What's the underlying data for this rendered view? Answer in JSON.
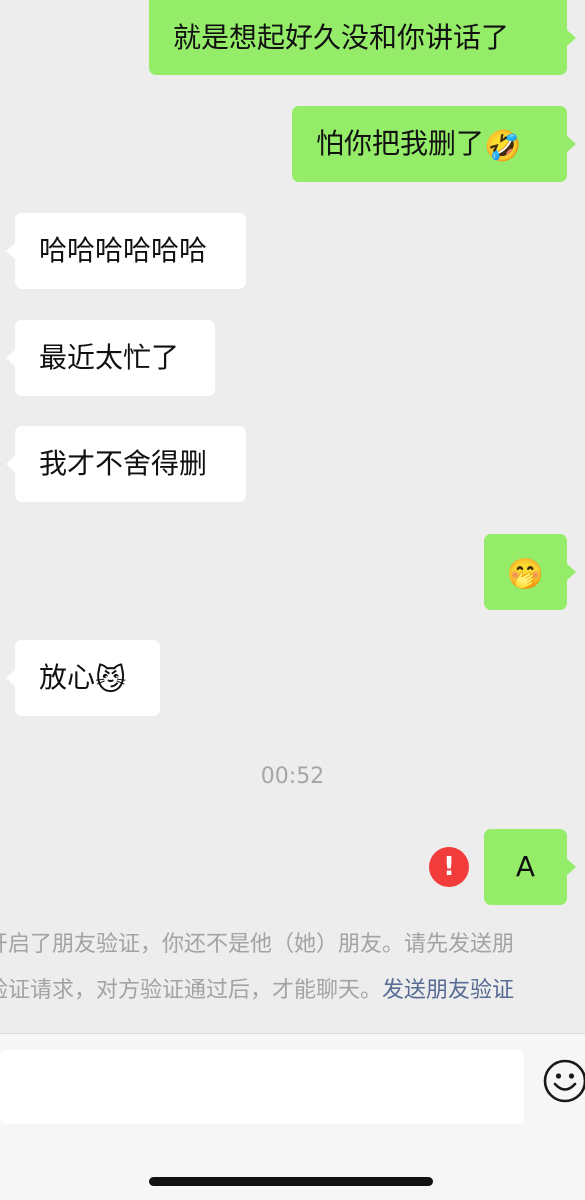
{
  "messages": [
    {
      "id": "m1",
      "side": "out",
      "text": "就是想起好久没和你讲话了",
      "emoji": ""
    },
    {
      "id": "m2",
      "side": "out",
      "text": "怕你把我删了",
      "emoji": "🤣"
    },
    {
      "id": "m3",
      "side": "in",
      "text": "哈哈哈哈哈哈",
      "emoji": ""
    },
    {
      "id": "m4",
      "side": "in",
      "text": "最近太忙了",
      "emoji": ""
    },
    {
      "id": "m5",
      "side": "in",
      "text": "我才不舍得删",
      "emoji": ""
    },
    {
      "id": "m6",
      "side": "out",
      "text": "",
      "emoji": "🤭"
    },
    {
      "id": "m7",
      "side": "in",
      "text": "放心",
      "emoji": "😼"
    },
    {
      "id": "m8",
      "side": "out",
      "text": "A",
      "emoji": "",
      "failed": true
    }
  ],
  "timestamp": "00:52",
  "failed_icon_glyph": "!",
  "system_note": {
    "line1": "开启了朋友验证，你还不是他（她）朋友。请先发送朋",
    "line2_prefix": "验证请求，对方验证通过后，才能聊天。",
    "line2_link": "发送朋友验证"
  },
  "input": {
    "value": "",
    "emoji_icon": "smiley-icon"
  },
  "colors": {
    "background": "#ededed",
    "outgoing_bubble": "#95ec69",
    "incoming_bubble": "#ffffff",
    "link": "#576b95",
    "error": "#f23b3b"
  }
}
